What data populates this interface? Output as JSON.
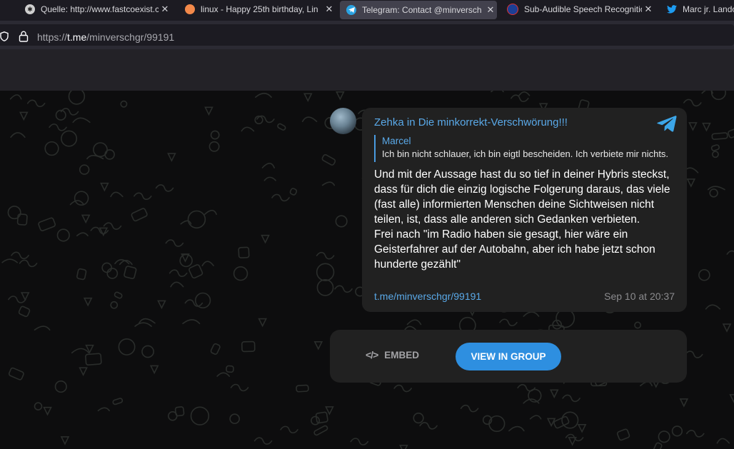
{
  "tabs": [
    {
      "title": "Quelle: http://www.fastcoexist.c",
      "active": false,
      "icon": "asterisk-icon"
    },
    {
      "title": "linux - Happy 25th birthday, Lin",
      "active": false,
      "icon": "orange-icon"
    },
    {
      "title": "Telegram: Contact @minversch",
      "active": true,
      "icon": "telegram-icon"
    },
    {
      "title": "Sub-Audible Speech Recognitio",
      "active": false,
      "icon": "nasa-icon"
    },
    {
      "title": "Marc jr. Landc",
      "active": false,
      "icon": "twitter-icon"
    }
  ],
  "url": {
    "scheme": "https://",
    "host": "t.me",
    "path": "/minverschgr/99191"
  },
  "message": {
    "author": "Zehka",
    "in_word": "in",
    "group": "Die minkorrekt-Verschwörung!!!",
    "reply_name": "Marcel",
    "reply_text": "Ich bin nicht schlauer, ich bin eigtl bescheiden. Ich verbiete mir nichts.",
    "text_p1": "Und mit der Aussage hast du so tief in deiner Hybris steckst, dass für dich die einzig logische Folgerung daraus, das viele (fast alle) informierten Menschen deine Sichtweisen nicht teilen, ist, dass alle anderen sich Gedanken verbieten.",
    "text_p2": "Frei nach \"im Radio haben sie gesagt, hier wäre ein Geisterfahrer auf der Autobahn, aber ich habe jetzt schon hunderte gezählt\"",
    "link": "t.me/minverschgr/99191",
    "date": "Sep 10 at 20:37"
  },
  "actions": {
    "embed_icon": "</>",
    "embed_label": "EMBED",
    "view_label": "VIEW IN GROUP"
  },
  "colors": {
    "accent": "#2e8fe0",
    "link": "#5aa9e8",
    "bubble": "#212121",
    "background": "#0d0d0e"
  }
}
